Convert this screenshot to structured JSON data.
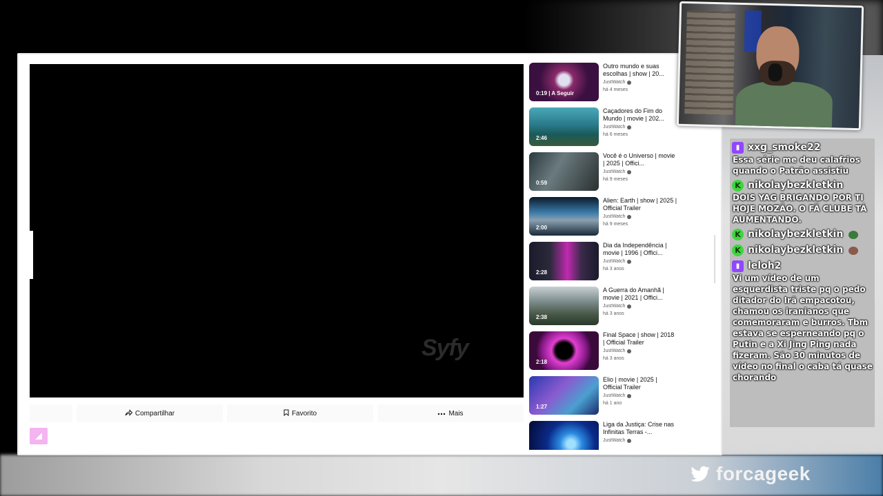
{
  "player": {
    "watermark": "Syfy"
  },
  "actions": [
    {
      "label": "",
      "icon": ""
    },
    {
      "label": "Compartilhar",
      "icon": "share-icon"
    },
    {
      "label": "Favorito",
      "icon": "bookmark-icon"
    },
    {
      "label": "Mais",
      "icon": "more-horizontal-icon"
    }
  ],
  "recommendations": [
    {
      "title": "Outro mundo e suas escolhas | show | 20...",
      "channel": "JustWatch",
      "age": "há 4 meses",
      "duration": "0:19 | A Seguir",
      "color": "#c02a4a"
    },
    {
      "title": "Caçadores do Fim do Mundo | movie | 202...",
      "channel": "JustWatch",
      "age": "há 6 meses",
      "duration": "2:46",
      "color": "#2a8a9a"
    },
    {
      "title": "Você é o Universo | movie | 2025 | Offici...",
      "channel": "JustWatch",
      "age": "há 9 meses",
      "duration": "0:59",
      "color": "#4a5a5e"
    },
    {
      "title": "Alien: Earth | show | 2025 | Official Trailer",
      "channel": "JustWatch",
      "age": "há 9 meses",
      "duration": "2:00",
      "color": "#1f3a5a"
    },
    {
      "title": "Dia da Independência | movie | 1996 | Offici...",
      "channel": "JustWatch",
      "age": "há 3 anos",
      "duration": "2:28",
      "color": "#3a2a4a"
    },
    {
      "title": "A Guerra do Amanhã | movie | 2021 | Offici...",
      "channel": "JustWatch",
      "age": "há 3 anos",
      "duration": "2:38",
      "color": "#5a6a6e"
    },
    {
      "title": "Final Space | show | 2018 | Official Trailer",
      "channel": "JustWatch",
      "age": "há 3 anos",
      "duration": "2:18",
      "color": "#b0289a"
    },
    {
      "title": "Elio | movie | 2025 | Official Trailer",
      "channel": "JustWatch",
      "age": "há 1 ano",
      "duration": "1:27",
      "color": "#3a4ab0"
    },
    {
      "title": "Liga da Justiça: Crise nas Infinitas Terras -...",
      "channel": "JustWatch",
      "age": "",
      "duration": "",
      "color": "#1a5ac0"
    }
  ],
  "chat": [
    {
      "user": "xxg_smoke22",
      "badge": "twitch",
      "text": "Essa série me deu calafrios quando o Patrão assistiu"
    },
    {
      "user": "nikolaybezkletkin",
      "badge": "kick",
      "text": "DOIS YAG BRIGANDO POR TI HOJE MOZÃO. O FÃ CLUBE TÁ AUMENTANDO."
    },
    {
      "user": "nikolaybezkletkin",
      "badge": "kick",
      "text": "",
      "emote": "#3a7a3a"
    },
    {
      "user": "nikolaybezkletkin",
      "badge": "kick",
      "text": "",
      "emote": "#8a5a4a"
    },
    {
      "user": "leloh2",
      "badge": "twitch",
      "text": "Vi um vídeo de um esquerdista triste pq o pedo ditador do Irã empacotou, chamou os iranianos que comemoraram e burros. Tbm estava se esperneando pq o Putin e a Xi Jing Ping nada fizeram. São 30 minutos de vídeo no final o caba tá quase chorando"
    }
  ],
  "brand": {
    "name": "forcageek",
    "icon": "twitter-bird-icon"
  }
}
